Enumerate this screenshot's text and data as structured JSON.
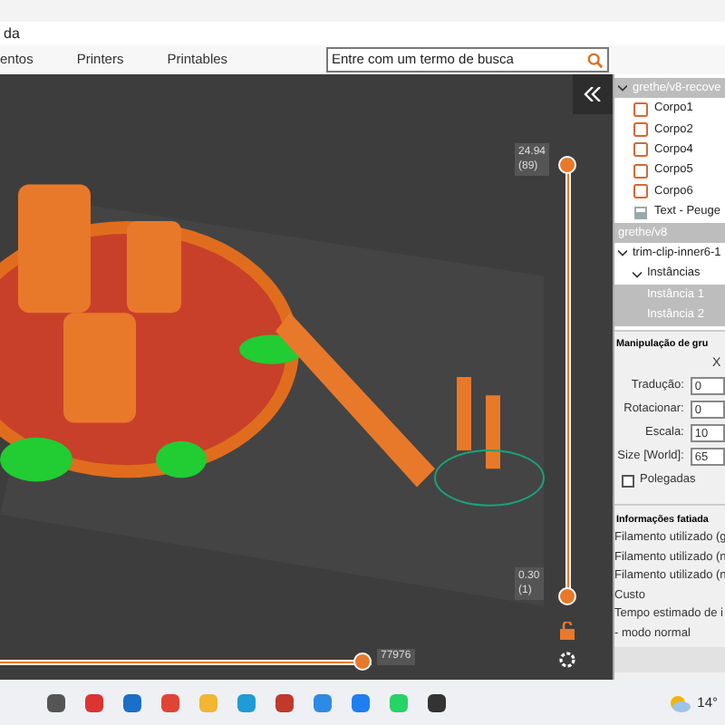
{
  "menu_bar": {
    "items": [
      "da"
    ]
  },
  "tabs": [
    {
      "label": "entos",
      "selected": false
    },
    {
      "label": "Printers",
      "selected": false
    },
    {
      "label": "Printables",
      "selected": false
    }
  ],
  "search": {
    "placeholder": "Entre com um termo de busca"
  },
  "viewport": {
    "kind": "picture",
    "top_label": [
      "24.94",
      "(89)"
    ],
    "bottom_label": [
      "0.30",
      "(1)"
    ],
    "move_label": "77976",
    "layer_slider": {
      "upper": {
        "level": 1
      },
      "lower": {
        "level": 0
      }
    },
    "move_slider": {
      "level": 1
    }
  },
  "object_list": [
    {
      "label": "grethe/v8-recove",
      "selected": true,
      "expanded": true,
      "children": [
        {
          "label": "Corpo1",
          "kind": "part",
          "selected": false
        },
        {
          "label": "Corpo2",
          "kind": "part",
          "selected": false
        },
        {
          "label": "Corpo4",
          "kind": "part",
          "selected": false
        },
        {
          "label": "Corpo5",
          "kind": "part",
          "selected": false
        },
        {
          "label": "Corpo6",
          "kind": "part",
          "selected": false
        },
        {
          "label": "Text - Peuge",
          "kind": "text",
          "selected": false
        }
      ]
    },
    {
      "label": "grethe/v8",
      "selected": true
    },
    {
      "label": "trim-clip-inner6-1",
      "selected": false,
      "expanded": true,
      "children": [
        {
          "label": "Instâncias",
          "selected": false,
          "expanded": true,
          "children": [
            {
              "label": "Instância 1",
              "selected": true
            },
            {
              "label": "Instância 2",
              "selected": true
            }
          ]
        }
      ]
    }
  ],
  "manipulation": {
    "title": "Manipulação de gru",
    "column": "X",
    "rows": [
      {
        "label": "Tradução:",
        "value": "0"
      },
      {
        "label": "Rotacionar:",
        "value": "0"
      },
      {
        "label": "Escala:",
        "value": "10"
      },
      {
        "label": "Size [World]:",
        "value": "65"
      }
    ],
    "inches": {
      "label": "Polegadas",
      "checked": false
    }
  },
  "slice_info": {
    "title": "Informações fatiada",
    "lines": [
      "Filamento utilizado (g",
      "Filamento utilizado (n",
      "Filamento utilizado (n",
      "Custo",
      "Tempo estimado de i",
      "- modo normal"
    ]
  },
  "taskbar": {
    "weather": "14°"
  }
}
